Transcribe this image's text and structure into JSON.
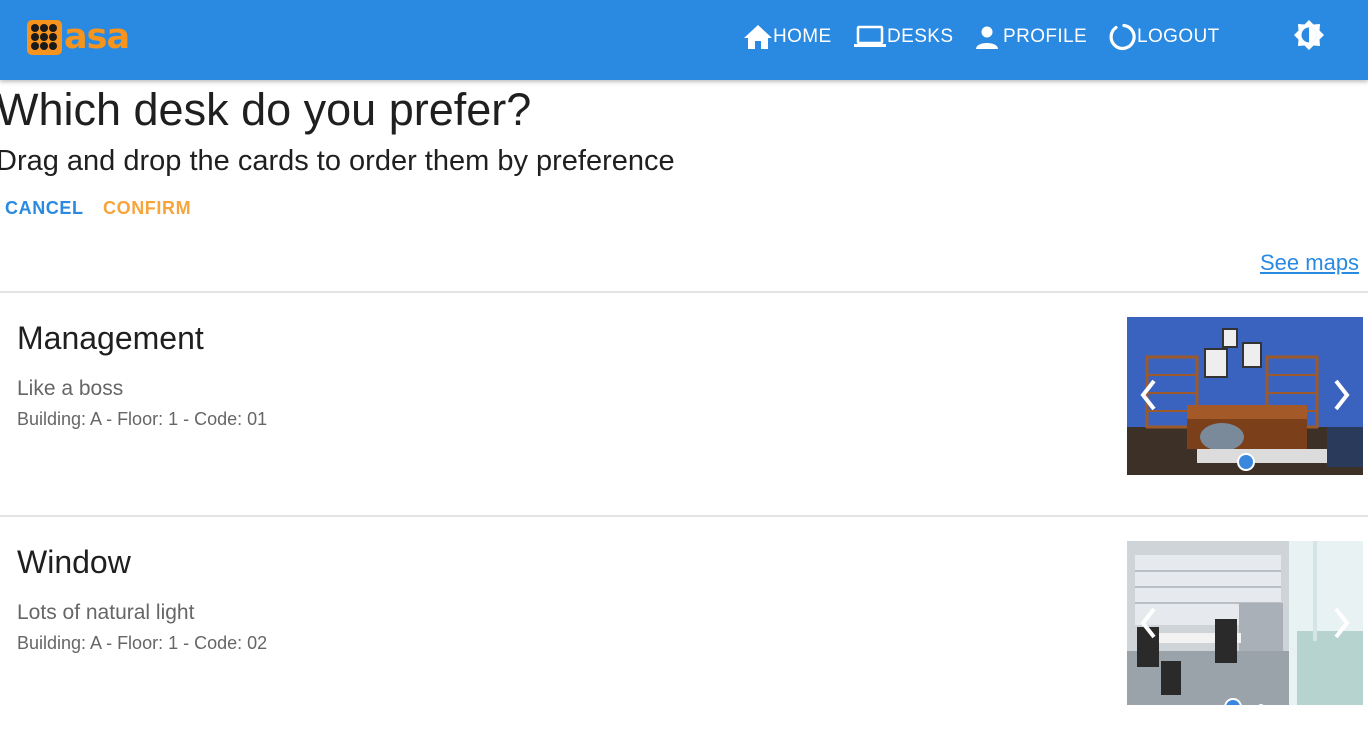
{
  "brand": {
    "logo_text": "asa",
    "accent": "#f7941d",
    "primary": "#2a8ae2"
  },
  "nav": {
    "home": {
      "label": "HOME",
      "icon": "home-icon"
    },
    "desks": {
      "label": "DESKS",
      "icon": "laptop-icon"
    },
    "profile": {
      "label": "PROFILE",
      "icon": "person-icon"
    },
    "logout": {
      "label": "LOGOUT",
      "icon": "power-icon"
    },
    "theme_toggle_icon": "brightness-icon"
  },
  "page": {
    "title": "Which desk do you prefer?",
    "subtitle": "Drag and drop the cards to order them by preference",
    "cancel_label": "CANCEL",
    "cancel_color": "#2a8ae2",
    "confirm_label": "CONFIRM",
    "confirm_color": "#f7a43a",
    "see_maps_label": "See maps"
  },
  "desks": [
    {
      "name": "Management",
      "description": "Like a boss",
      "details": "Building: A - Floor: 1 - Code: 01",
      "carousel": {
        "slides": 1,
        "active": 1
      }
    },
    {
      "name": "Window",
      "description": "Lots of natural light",
      "details": "Building: A - Floor: 1 - Code: 02",
      "carousel": {
        "slides": 2,
        "active": 1
      }
    }
  ]
}
